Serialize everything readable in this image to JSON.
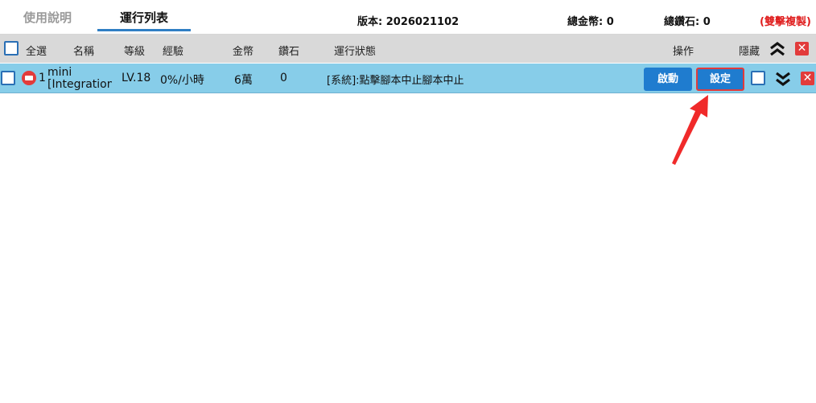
{
  "tabs": {
    "help": "使用說明",
    "run_list": "運行列表"
  },
  "info": {
    "version": "版本: 2026021102",
    "total_coins": "總金幣:  0",
    "total_diamonds": "總鑽石:  0",
    "double_click_copy": "(雙擊複製)"
  },
  "header": {
    "select_all": "全選",
    "name": "名稱",
    "level": "等級",
    "exp": "經驗",
    "coins": "金幣",
    "diamonds": "鑽石",
    "status": "運行狀態",
    "actions": "操作",
    "hide": "隱藏"
  },
  "row": {
    "index": "1",
    "name": "mini [Integration",
    "level": "LV.18",
    "exp": "0%/小時",
    "coins": "6萬",
    "diamonds": "0",
    "status": "[系統]:點擊腳本中止腳本中止",
    "start_label": "啟動",
    "settings_label": "設定"
  },
  "icons": {
    "collapse_all": "double-chevron-up-icon",
    "expand": "double-chevron-down-icon",
    "close": "close-icon",
    "status": "stop-status-icon",
    "annotation": "red-arrow-icon"
  },
  "colors": {
    "accent": "#1f7ccf",
    "row_bg": "#87cde9",
    "header_bg": "#d9d9d9",
    "danger": "#e23b3b"
  }
}
